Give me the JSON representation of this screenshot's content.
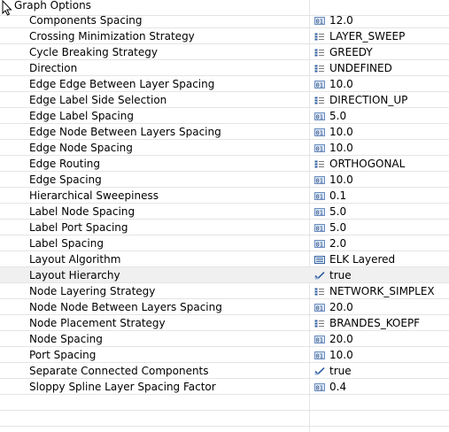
{
  "header": {
    "title": "Graph Options"
  },
  "properties": [
    {
      "name": "Components Spacing",
      "value": "12.0",
      "icon": "number-icon"
    },
    {
      "name": "Crossing Minimization Strategy",
      "value": "LAYER_SWEEP",
      "icon": "enum-icon"
    },
    {
      "name": "Cycle Breaking Strategy",
      "value": "GREEDY",
      "icon": "enum-icon"
    },
    {
      "name": "Direction",
      "value": "UNDEFINED",
      "icon": "enum-icon"
    },
    {
      "name": "Edge Edge Between Layer Spacing",
      "value": "10.0",
      "icon": "number-icon"
    },
    {
      "name": "Edge Label Side Selection",
      "value": "DIRECTION_UP",
      "icon": "enum-icon"
    },
    {
      "name": "Edge Label Spacing",
      "value": "5.0",
      "icon": "number-icon"
    },
    {
      "name": "Edge Node Between Layers Spacing",
      "value": "10.0",
      "icon": "number-icon"
    },
    {
      "name": "Edge Node Spacing",
      "value": "10.0",
      "icon": "number-icon"
    },
    {
      "name": "Edge Routing",
      "value": "ORTHOGONAL",
      "icon": "enum-icon"
    },
    {
      "name": "Edge Spacing",
      "value": "10.0",
      "icon": "number-icon"
    },
    {
      "name": "Hierarchical Sweepiness",
      "value": "0.1",
      "icon": "number-icon"
    },
    {
      "name": "Label Node Spacing",
      "value": "5.0",
      "icon": "number-icon"
    },
    {
      "name": "Label Port Spacing",
      "value": "5.0",
      "icon": "number-icon"
    },
    {
      "name": "Label Spacing",
      "value": "2.0",
      "icon": "number-icon"
    },
    {
      "name": "Layout Algorithm",
      "value": "ELK Layered",
      "icon": "list-icon"
    },
    {
      "name": "Layout Hierarchy",
      "value": "true",
      "icon": "checkbox-icon",
      "selected": true
    },
    {
      "name": "Node Layering Strategy",
      "value": "NETWORK_SIMPLEX",
      "icon": "enum-icon"
    },
    {
      "name": "Node Node Between Layers Spacing",
      "value": "20.0",
      "icon": "number-icon"
    },
    {
      "name": "Node Placement Strategy",
      "value": "BRANDES_KOEPF",
      "icon": "enum-icon"
    },
    {
      "name": "Node Spacing",
      "value": "20.0",
      "icon": "number-icon"
    },
    {
      "name": "Port Spacing",
      "value": "10.0",
      "icon": "number-icon"
    },
    {
      "name": "Separate Connected Components",
      "value": "true",
      "icon": "checkbox-icon"
    },
    {
      "name": "Sloppy Spline Layer Spacing Factor",
      "value": "0.4",
      "icon": "number-icon"
    }
  ],
  "colors": {
    "grid": "#e4e4e4",
    "selected_row": "#f0f0f0",
    "icon_blue": "#2f5f9e"
  }
}
